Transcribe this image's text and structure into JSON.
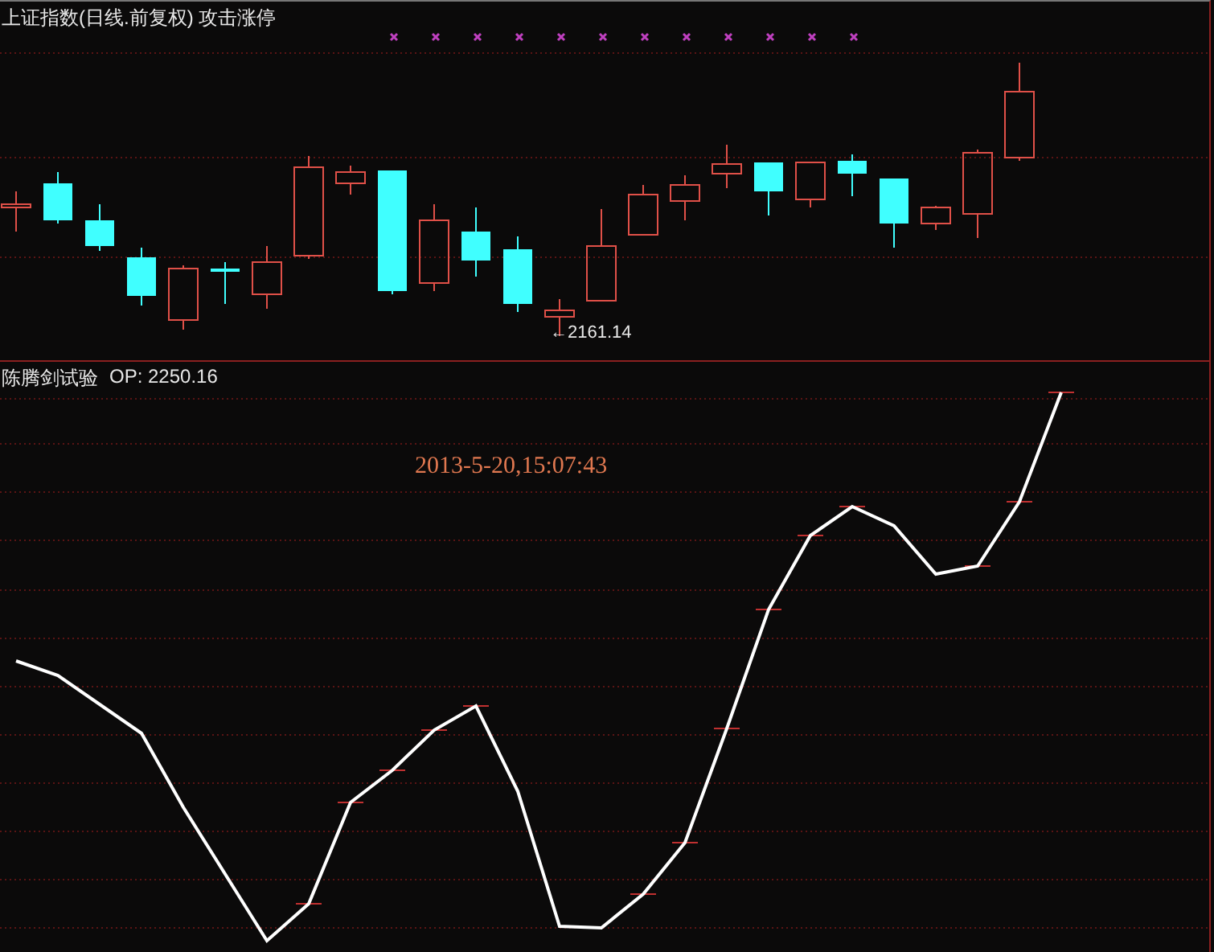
{
  "main_chart": {
    "title": "上证指数(日线.前复权) 攻击涨停",
    "low_label": "←2161.14"
  },
  "indicator_chart": {
    "name": "陈腾剑试验",
    "op_label": "OP: 2250.16",
    "timestamp": "2013-5-20,15:07:43"
  }
}
